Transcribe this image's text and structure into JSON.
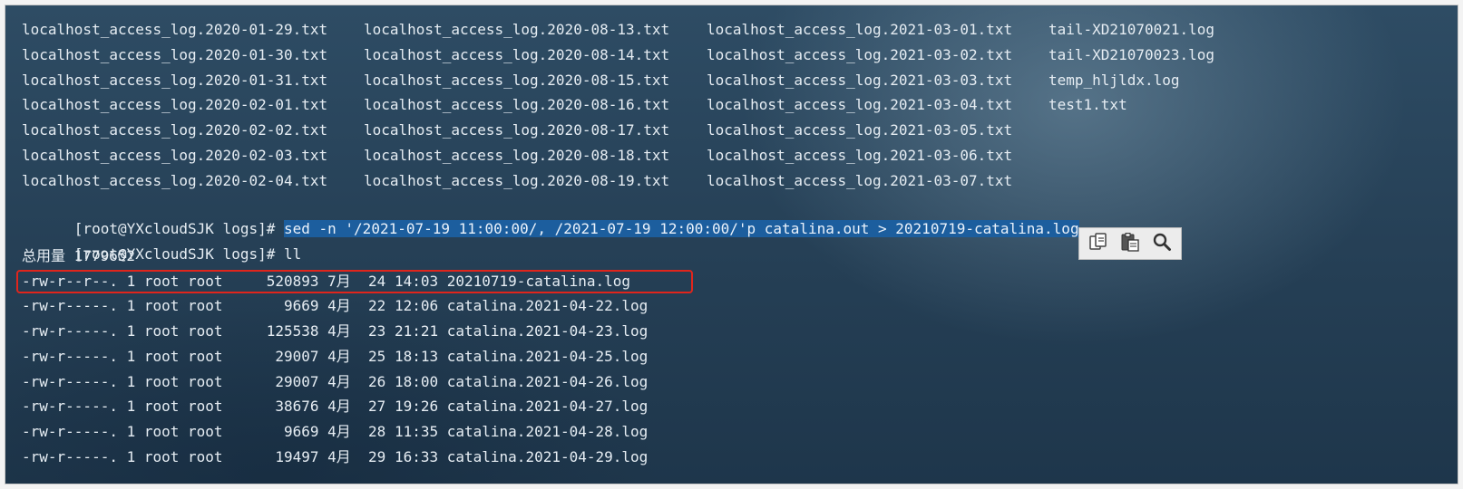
{
  "listing_rows": [
    [
      "localhost_access_log.2020-01-29.txt",
      "localhost_access_log.2020-08-13.txt",
      "localhost_access_log.2021-03-01.txt",
      "tail-XD21070021.log"
    ],
    [
      "localhost_access_log.2020-01-30.txt",
      "localhost_access_log.2020-08-14.txt",
      "localhost_access_log.2021-03-02.txt",
      "tail-XD21070023.log"
    ],
    [
      "localhost_access_log.2020-01-31.txt",
      "localhost_access_log.2020-08-15.txt",
      "localhost_access_log.2021-03-03.txt",
      "temp_hljldx.log"
    ],
    [
      "localhost_access_log.2020-02-01.txt",
      "localhost_access_log.2020-08-16.txt",
      "localhost_access_log.2021-03-04.txt",
      "test1.txt"
    ],
    [
      "localhost_access_log.2020-02-02.txt",
      "localhost_access_log.2020-08-17.txt",
      "localhost_access_log.2021-03-05.txt",
      ""
    ],
    [
      "localhost_access_log.2020-02-03.txt",
      "localhost_access_log.2020-08-18.txt",
      "localhost_access_log.2021-03-06.txt",
      ""
    ],
    [
      "localhost_access_log.2020-02-04.txt",
      "localhost_access_log.2020-08-19.txt",
      "localhost_access_log.2021-03-07.txt",
      ""
    ]
  ],
  "prompt": "[root@YXcloudSJK logs]# ",
  "command1": "sed -n '/2021-07-19 11:00:00/, /2021-07-19 12:00:00/'p catalina.out > 20210719-catalina.log",
  "command2": "ll",
  "total_line": "总用量 1779652",
  "ll_rows": [
    "-rw-r--r--. 1 root root     520893 7月  24 14:03 20210719-catalina.log",
    "-rw-r-----. 1 root root       9669 4月  22 12:06 catalina.2021-04-22.log",
    "-rw-r-----. 1 root root     125538 4月  23 21:21 catalina.2021-04-23.log",
    "-rw-r-----. 1 root root      29007 4月  25 18:13 catalina.2021-04-25.log",
    "-rw-r-----. 1 root root      29007 4月  26 18:00 catalina.2021-04-26.log",
    "-rw-r-----. 1 root root      38676 4月  27 19:26 catalina.2021-04-27.log",
    "-rw-r-----. 1 root root       9669 4月  28 11:35 catalina.2021-04-28.log",
    "-rw-r-----. 1 root root      19497 4月  29 16:33 catalina.2021-04-29.log"
  ],
  "toolbar": {
    "icons": [
      "copy-icon",
      "paste-icon",
      "search-icon"
    ]
  },
  "colors": {
    "highlight": "#1c5e9e",
    "annotation_box": "#e0251c"
  }
}
